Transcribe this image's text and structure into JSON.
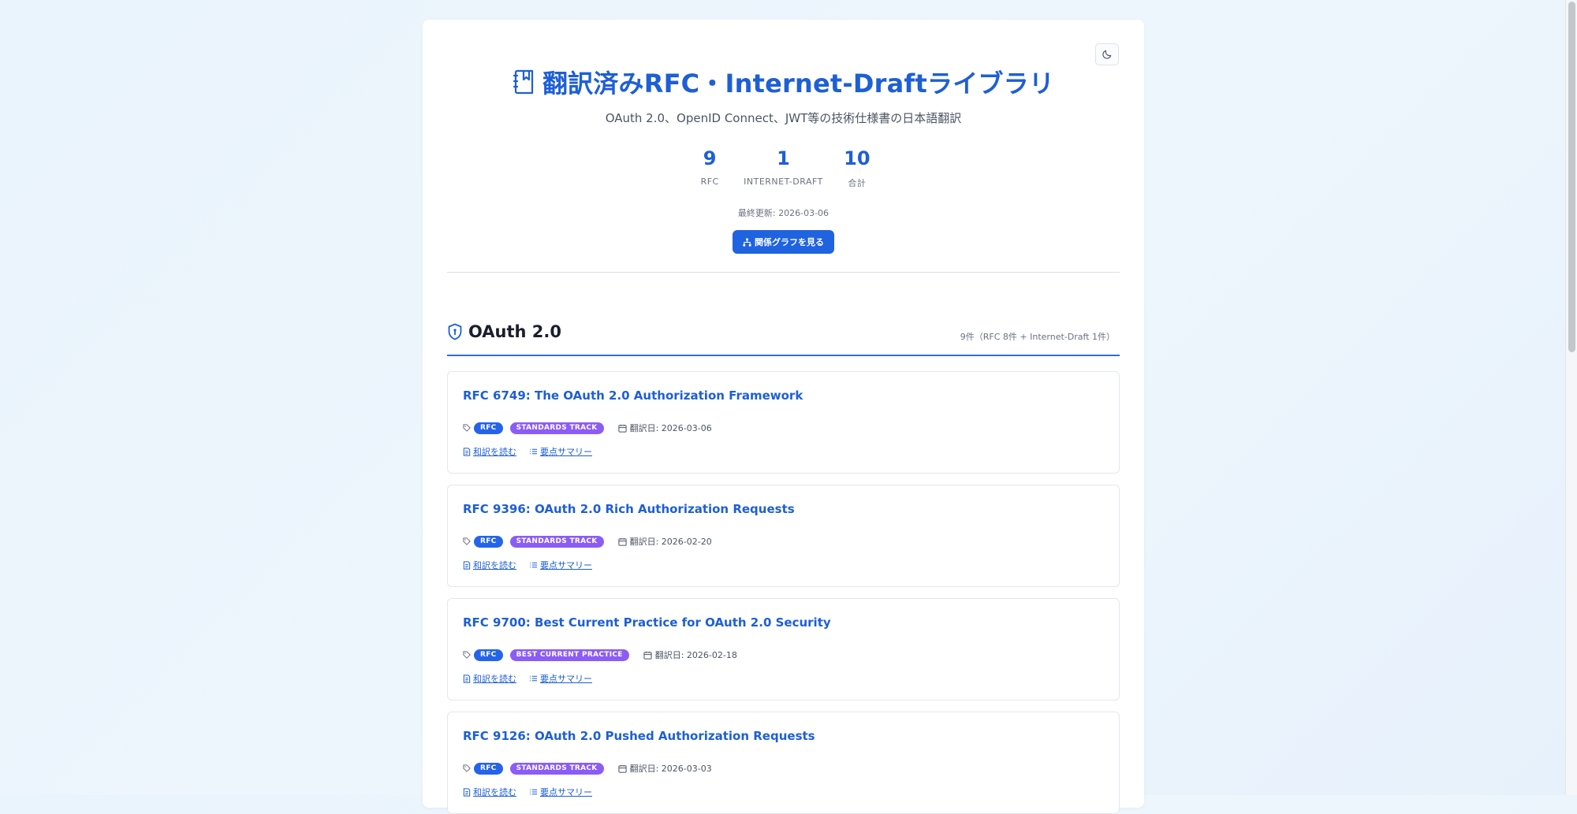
{
  "header": {
    "title": "翻訳済みRFC・Internet-Draftライブラリ",
    "subtitle": "OAuth 2.0、OpenID Connect、JWT等の技術仕様書の日本語翻訳",
    "stats": [
      {
        "value": "9",
        "label": "RFC"
      },
      {
        "value": "1",
        "label": "INTERNET-DRAFT"
      },
      {
        "value": "10",
        "label": "合計"
      }
    ],
    "last_updated": "最終更新: 2026-03-06",
    "graph_button": "関係グラフを見る"
  },
  "section": {
    "title": "OAuth 2.0",
    "count": "9件（RFC 8件 + Internet-Draft 1件）"
  },
  "documents": [
    {
      "title": "RFC 6749: The OAuth 2.0 Authorization Framework",
      "type": "RFC",
      "status": "STANDARDS TRACK",
      "date": "翻訳日: 2026-03-06",
      "read_label": "和訳を読む",
      "summary_label": "要点サマリー"
    },
    {
      "title": "RFC 9396: OAuth 2.0 Rich Authorization Requests",
      "type": "RFC",
      "status": "STANDARDS TRACK",
      "date": "翻訳日: 2026-02-20",
      "read_label": "和訳を読む",
      "summary_label": "要点サマリー"
    },
    {
      "title": "RFC 9700: Best Current Practice for OAuth 2.0 Security",
      "type": "RFC",
      "status": "BEST CURRENT PRACTICE",
      "date": "翻訳日: 2026-02-18",
      "read_label": "和訳を読む",
      "summary_label": "要点サマリー"
    },
    {
      "title": "RFC 9126: OAuth 2.0 Pushed Authorization Requests",
      "type": "RFC",
      "status": "STANDARDS TRACK",
      "date": "翻訳日: 2026-03-03",
      "read_label": "和訳を読む",
      "summary_label": "要点サマリー"
    }
  ],
  "colors": {
    "accent": "#1d5fd6",
    "button": "#1f63e0",
    "badge_rfc": "#2563eb",
    "badge_status": "#8b5cf6",
    "section_rule": "#2e6de3"
  },
  "icons": {
    "theme_toggle": "moon-icon",
    "title": "book-icon",
    "section": "shield-icon",
    "graph_button": "network-icon",
    "tag": "tag-icon",
    "date": "calendar-icon",
    "read": "document-icon",
    "summary": "list-icon"
  }
}
